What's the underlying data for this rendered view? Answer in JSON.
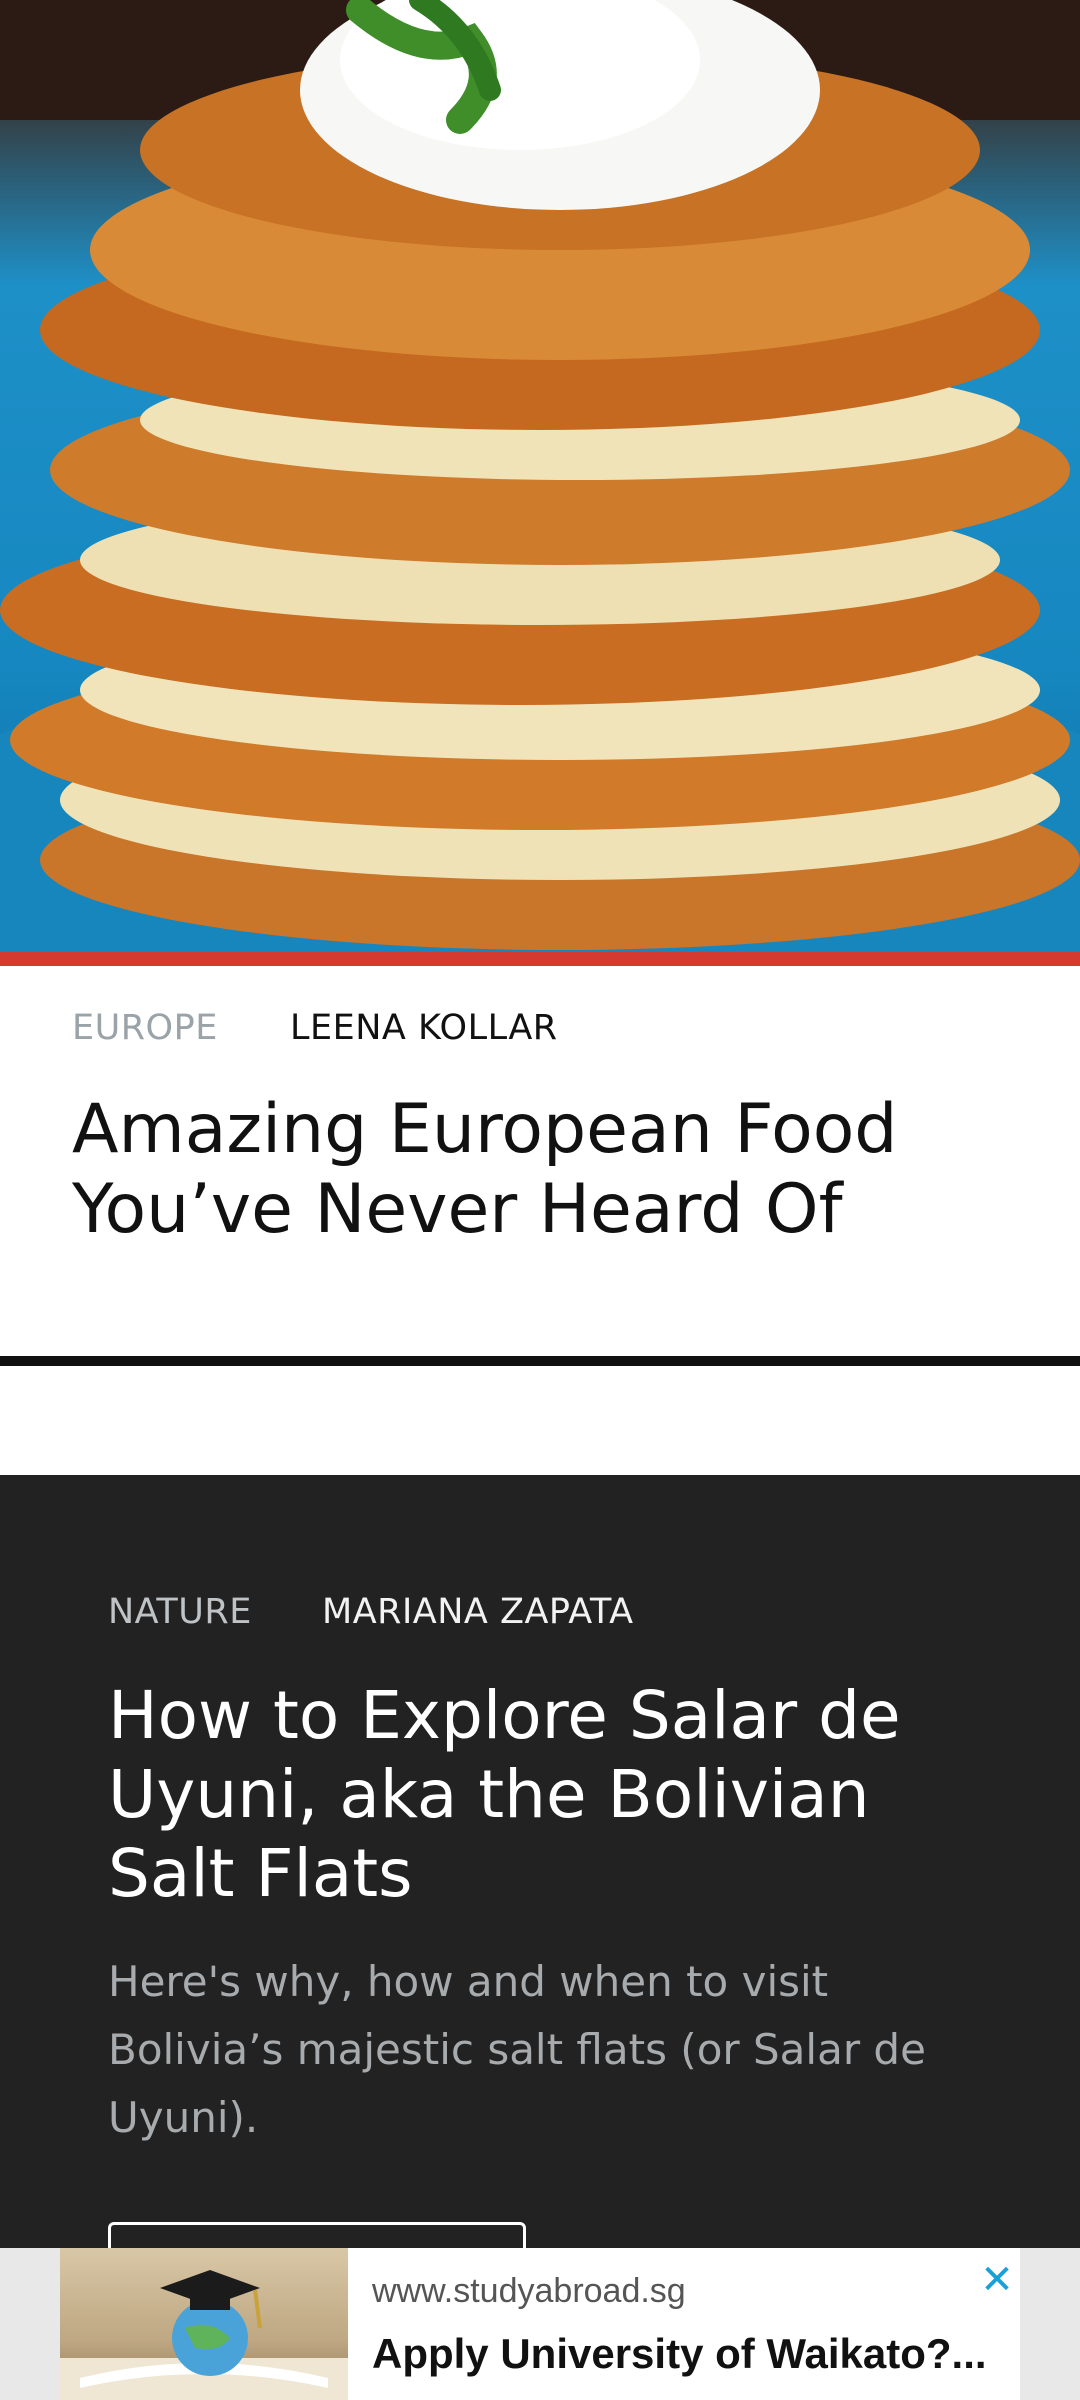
{
  "articles": [
    {
      "category": "EUROPE",
      "author": "LEENA KOLLAR",
      "title": "Amazing European Food You’ve Never Heard Of",
      "image": "potato-pancakes-stack"
    },
    {
      "category": "NATURE",
      "author": "MARIANA ZAPATA",
      "title": "How to Explore Salar de Uyuni, aka the Bolivian Salt Flats",
      "description": "Here's why, how and when to visit Bolivia’s majestic salt flats (or Salar de Uyuni)."
    }
  ],
  "ad": {
    "url": "www.studyabroad.sg",
    "title": "Apply University of Waikato?...",
    "close_icon": "close-icon"
  },
  "colors": {
    "accent_red": "#d43a2f",
    "dark_card": "#222222",
    "ad_close": "#1aa0d8"
  }
}
